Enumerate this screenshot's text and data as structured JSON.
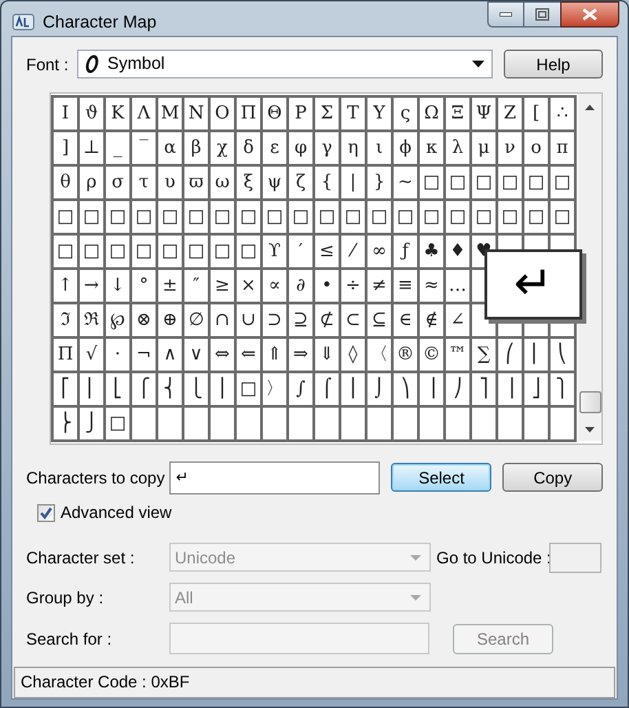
{
  "window": {
    "title": "Character Map"
  },
  "font": {
    "label": "Font :",
    "value": "Symbol"
  },
  "help_button": {
    "label": "Help"
  },
  "grid": {
    "rows": [
      [
        "Ι",
        "ϑ",
        "Κ",
        "Λ",
        "Μ",
        "Ν",
        "Ο",
        "Π",
        "Θ",
        "Ρ",
        "Σ",
        "Τ",
        "Υ",
        "ς",
        "Ω",
        "Ξ",
        "Ψ",
        "Ζ",
        "[",
        "∴"
      ],
      [
        "]",
        "⊥",
        "_",
        "‾",
        "α",
        "β",
        "χ",
        "δ",
        "ε",
        "φ",
        "γ",
        "η",
        "ι",
        "ϕ",
        "κ",
        "λ",
        "μ",
        "ν",
        "ο",
        "π"
      ],
      [
        "θ",
        "ρ",
        "σ",
        "τ",
        "υ",
        "ϖ",
        "ω",
        "ξ",
        "ψ",
        "ζ",
        "{",
        "|",
        "}",
        "~",
        "□",
        "□",
        "□",
        "□",
        "□",
        "□"
      ],
      [
        "□",
        "□",
        "□",
        "□",
        "□",
        "□",
        "□",
        "□",
        "□",
        "□",
        "□",
        "□",
        "□",
        "□",
        "□",
        "□",
        "□",
        "□",
        "□",
        "□"
      ],
      [
        "□",
        "□",
        "□",
        "□",
        "□",
        "□",
        "□",
        "□",
        "ϒ",
        "′",
        "≤",
        "⁄",
        "∞",
        "ƒ",
        "♣",
        "♦",
        "♥",
        null,
        null,
        null
      ],
      [
        "↑",
        "→",
        "↓",
        "°",
        "±",
        "″",
        "≥",
        "×",
        "∝",
        "∂",
        "•",
        "÷",
        "≠",
        "≡",
        "≈",
        "…",
        null
      ],
      [
        "ℑ",
        "ℜ",
        "℘",
        "⊗",
        "⊕",
        "∅",
        "∩",
        "∪",
        "⊃",
        "⊇",
        "⊄",
        "⊂",
        "⊆",
        "∈",
        "∉",
        "∠",
        null,
        null,
        null,
        null
      ],
      [
        "Π",
        "√",
        "⋅",
        "¬",
        "∧",
        "∨",
        "⇔",
        "⇐",
        "⇑",
        "⇒",
        "⇓",
        "◊",
        "〈",
        "®",
        "©",
        "™",
        "∑",
        "⎛",
        "⎜",
        "⎝"
      ],
      [
        "⎡",
        "⎢",
        "⎣",
        "⎧",
        "⎨",
        "⎩",
        "⎪",
        "□",
        "〉",
        "∫",
        "⌠",
        "⎮",
        "⌡",
        "⎞",
        "⎟",
        "⎠",
        "⎤",
        "⎥",
        "⎦",
        "⎫"
      ],
      [
        "⎬",
        "⎭",
        "□",
        null,
        null,
        null,
        null,
        null,
        null,
        null,
        null,
        null,
        null,
        null,
        null,
        null,
        null,
        null,
        null,
        null
      ]
    ],
    "preview": "↵"
  },
  "copy_field": {
    "label": "Characters to copy",
    "value": "↵"
  },
  "select_button": {
    "label": "Select",
    "default": true
  },
  "copy_button": {
    "label": "Copy"
  },
  "advanced_view": {
    "label": "Advanced view",
    "checked": true
  },
  "character_set": {
    "label": "Character set :",
    "value": "Unicode",
    "disabled": true
  },
  "go_to_unicode": {
    "label": "Go to Unicode :"
  },
  "group_by": {
    "label": "Group by :",
    "value": "All",
    "disabled": true
  },
  "search_for": {
    "label": "Search for :",
    "disabled": true
  },
  "search_button": {
    "label": "Search",
    "disabled": true
  },
  "status_bar": {
    "text": "Character Code : 0xBF"
  }
}
